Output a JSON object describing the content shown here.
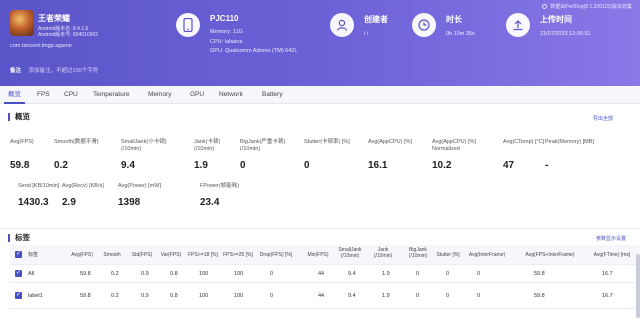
{
  "header": {
    "update_text": "数据由PerfDog(8.1.230120)版本收集",
    "game": {
      "title": "王者荣耀",
      "android_version_line": "Android版本名: 8.4.1.6",
      "android_code_line": "Android版本号: 804010602",
      "package": "com.tencent.tmgp.sgame"
    },
    "device": {
      "name": "PJC110",
      "memory": "Memory: 11G",
      "cpu": "CPU: lahaina",
      "gpu": "GPU: Qualcomm Adreno (TM) 642L",
      "icon": "phone-icon"
    },
    "creator": {
      "label": "创建者",
      "value": "i i",
      "icon": "user-icon"
    },
    "duration": {
      "label": "时长",
      "value": "0h 10m 35s",
      "icon": "clock-icon"
    },
    "upload": {
      "label": "上传时间",
      "value": "21/07/2023 12:06:51",
      "icon": "upload-icon"
    }
  },
  "note": {
    "label": "备注",
    "text": "添加备注，不超过100个字符"
  },
  "tabs": [
    "概览",
    "FPS",
    "CPU",
    "Temperature",
    "Memory",
    "GPU",
    "Network",
    "Battery"
  ],
  "overview": {
    "title": "概览",
    "export_link": "导出全部",
    "metrics_row1": [
      {
        "label": "Avg(FPS)",
        "value": "59.8"
      },
      {
        "label": "Smooth(数据平滑)",
        "value": "0.2"
      },
      {
        "label": "SmallJank(小卡顿)",
        "label2": "(/10min)",
        "value": "9.4"
      },
      {
        "label": "Jank(卡顿)",
        "label2": "(/10min)",
        "value": "1.9"
      },
      {
        "label": "BigJank(严重卡顿)",
        "label2": "(/10min)",
        "value": "0"
      },
      {
        "label": "Stutter(卡顿率) [%]",
        "value": "0"
      },
      {
        "label": "Avg(AppCPU) [%]",
        "value": "16.1"
      },
      {
        "label": "Avg(AppCPU) [%]",
        "label2": "Normalized",
        "value": "10.2"
      },
      {
        "label": "Avg(CTemp) [°C]",
        "value": "47"
      },
      {
        "label": "Peak(Memory) [MB]",
        "value": "-"
      }
    ],
    "metrics_row2": [
      {
        "label": "Send [KB/10min]",
        "value": "1430.3"
      },
      {
        "label": "Avg(Recv) [KB/s]",
        "value": "2.9"
      },
      {
        "label": "Avg(Power) [mW]",
        "value": "1398"
      },
      {
        "label": "FPower(帧能耗)",
        "value": "23.4"
      }
    ]
  },
  "labels": {
    "title": "标签",
    "settings_link": "参数显示设置",
    "columns": [
      "标签",
      "Avg(FPS)",
      "Smooth",
      "Std(FPS)",
      "Var(FPS)",
      "FPS>=18 [%]",
      "FPS>=25 [%]",
      "Drop(FPS) [%]",
      "Min(FPS)",
      "SmallJank (/10min)",
      "Jank (/10min)",
      "BigJank (/10min)",
      "Stutter [%]",
      "Avg(InterFrame)",
      "Avg(FPS+InterFrame)",
      "Avg(FTime) [ms]"
    ],
    "rows": [
      {
        "name": "All",
        "values": [
          "59.8",
          "0.2",
          "0.9",
          "0.8",
          "100",
          "100",
          "0",
          "44",
          "9.4",
          "1.9",
          "0",
          "0",
          "0",
          "59.8",
          "16.7"
        ]
      },
      {
        "name": "label1",
        "values": [
          "59.8",
          "0.2",
          "0.9",
          "0.8",
          "100",
          "100",
          "0",
          "44",
          "9.4",
          "1.9",
          "0",
          "0",
          "0",
          "59.8",
          "16.7"
        ]
      }
    ]
  }
}
